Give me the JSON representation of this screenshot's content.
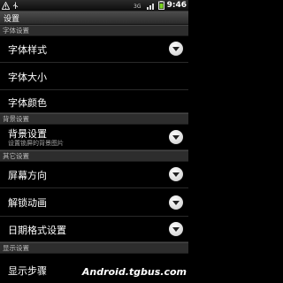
{
  "status_bar": {
    "time": "9:46"
  },
  "title": "设置",
  "sections": {
    "font": "字体设置",
    "background": "背景设置",
    "other": "其它设置",
    "display": "显示设置"
  },
  "items": {
    "font_style": "字体样式",
    "font_size": "字体大小",
    "font_color": "字体颜色",
    "bg_setting": "背景设置",
    "bg_setting_sub": "设置锁屏的背景图片",
    "screen_orientation": "屏幕方向",
    "unlock_animation": "解锁动画",
    "date_format": "日期格式设置",
    "show_steps": "显示步骤"
  },
  "watermark": "Android.tgbus.com"
}
